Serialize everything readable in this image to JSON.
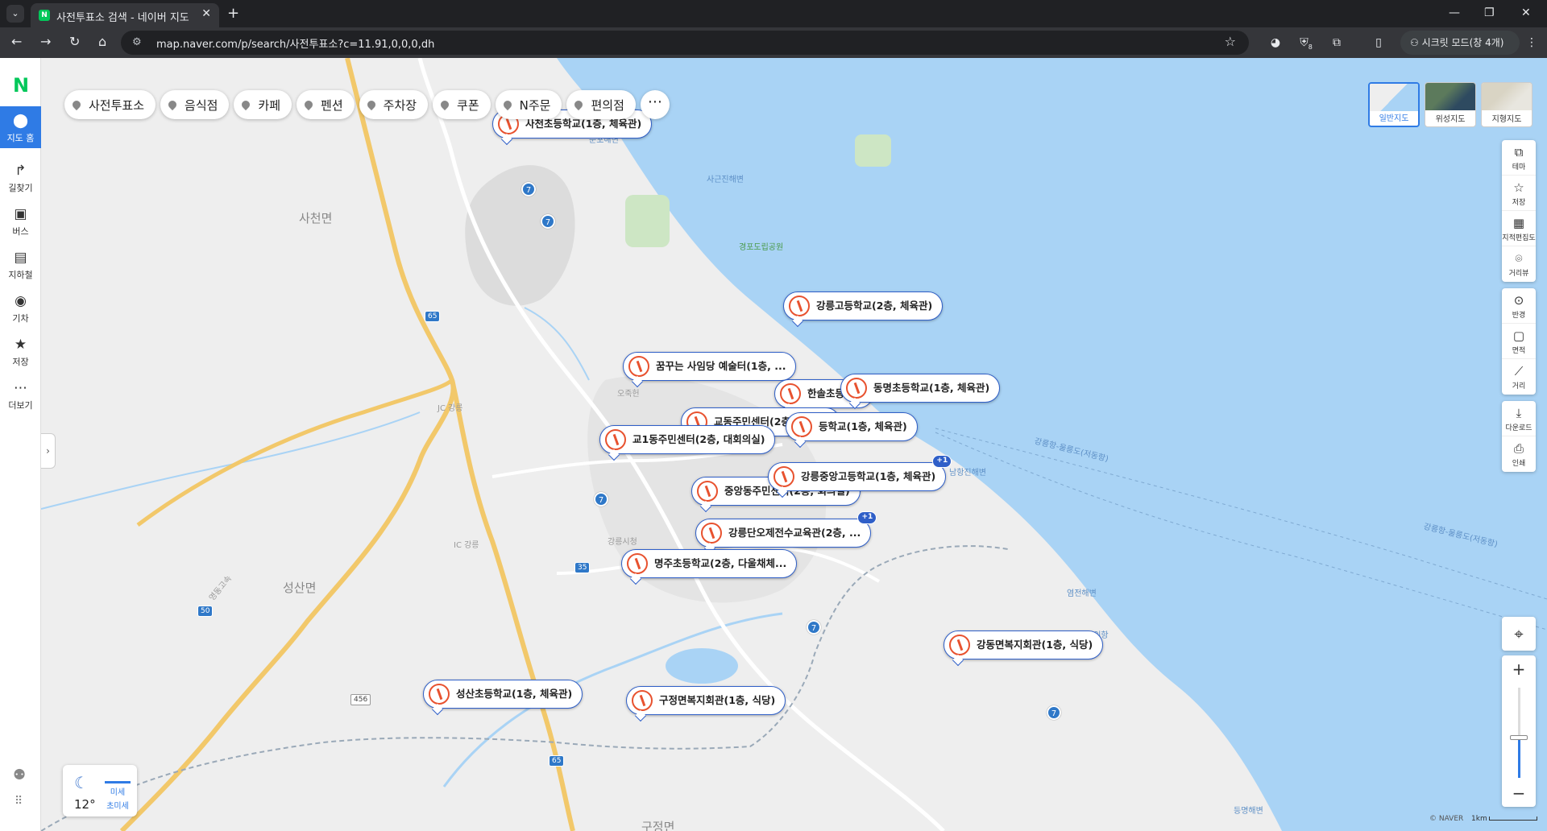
{
  "browser": {
    "tab_title": "사전투표소 검색 - 네이버 지도",
    "tab_favicon": "N",
    "url": "map.naver.com/p/search/사전투표소?c=11.91,0,0,0,dh",
    "incognito_label": "시크릿 모드(창 4개)",
    "ext_badge": "8"
  },
  "sidebar": {
    "logo": "N",
    "items": [
      {
        "label": "지도 홈",
        "icon": "map-pin-icon",
        "glyph": "⬤",
        "active": true
      },
      {
        "label": "길찾기",
        "icon": "directions-icon",
        "glyph": "↱"
      },
      {
        "label": "버스",
        "icon": "bus-icon",
        "glyph": "▣"
      },
      {
        "label": "지하철",
        "icon": "subway-icon",
        "glyph": "▤"
      },
      {
        "label": "기차",
        "icon": "train-icon",
        "glyph": "◉"
      },
      {
        "label": "저장",
        "icon": "star-icon",
        "glyph": "★"
      },
      {
        "label": "더보기",
        "icon": "more-icon",
        "glyph": "⋯"
      }
    ]
  },
  "chips": [
    "사전투표소",
    "음식점",
    "카페",
    "펜션",
    "주차장",
    "쿠폰",
    "N주문",
    "편의점"
  ],
  "map_types": [
    {
      "label": "일반지도",
      "active": true
    },
    {
      "label": "위성지도"
    },
    {
      "label": "지형지도"
    }
  ],
  "tools": {
    "group1": [
      "테마",
      "저장",
      "지적편집도",
      "거리뷰"
    ],
    "group2": [
      "반경",
      "면적",
      "거리"
    ],
    "group3": [
      "다운로드",
      "인쇄"
    ]
  },
  "zoom": {
    "level_fraction": 0.45
  },
  "footer": {
    "copyright": "© NAVER",
    "scale": "1km"
  },
  "weather": {
    "temp": "12°",
    "air1": "미세",
    "air2": "초미세"
  },
  "map_labels": {
    "sacheon": "사천면",
    "seongsan": "성산면",
    "gujeong": "구정면",
    "sunpo": "순포해변",
    "sageun": "사근진해변",
    "gyeongpo": "경포도립공원",
    "ojuk": "오죽헌",
    "jc": "JC 강릉",
    "ic": "IC 강릉",
    "city_hall": "강릉시청",
    "namhang": "남항진해변",
    "yeomjeon": "염전해변",
    "anin": "안인항",
    "deungmyeong": "등명해변",
    "ferry1": "강릉항-울릉도(저동항)",
    "ferry2": "강릉항-울릉도(저동항)",
    "expressway": "영동고속"
  },
  "road_shields": {
    "r7a": "7",
    "r7b": "7",
    "r7c": "7",
    "r7d": "7",
    "r7e": "7",
    "e65a": "65",
    "e65b": "65",
    "e50": "50",
    "r35": "35",
    "n456": "456"
  },
  "markers": [
    {
      "label": "사천초등학교(1층, 체육관)"
    },
    {
      "label": "강릉고등학교(2층, 체육관)"
    },
    {
      "label": "꿈꾸는 사임당 예술터(1층, ..."
    },
    {
      "label": "한솔초등학교"
    },
    {
      "label": "동명초등학교(1층, 체육관)"
    },
    {
      "label": "교동주민센터(2층, 회의실)"
    },
    {
      "label": "등학교(1층, 체육관)"
    },
    {
      "label": "교1동주민센터(2층, 대회의실)"
    },
    {
      "label": "강릉중앙고등학교(1층, 체육관)",
      "extra": "+1"
    },
    {
      "label": "중앙동주민센터(2층, 회의실)"
    },
    {
      "label": "강릉단오제전수교육관(2층, ...",
      "extra": "+1"
    },
    {
      "label": "명주초등학교(2층, 다울채체..."
    },
    {
      "label": "강동면복지회관(1층, 식당)"
    },
    {
      "label": "성산초등학교(1층, 체육관)"
    },
    {
      "label": "구정면복지회관(1층, 식당)"
    }
  ],
  "colors": {
    "accent": "#2f7be5",
    "brand": "#03c75a",
    "marker_border": "#2f5fc8",
    "vote_icon": "#e8522f",
    "sea": "#a9d3f5"
  }
}
